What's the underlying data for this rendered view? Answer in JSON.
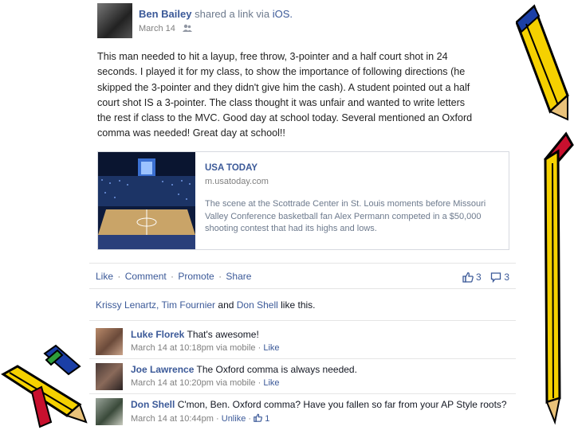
{
  "post": {
    "author": "Ben Bailey",
    "verb": "shared a link via",
    "platform": "iOS.",
    "date": "March 14",
    "message_lines": [
      "This man needed to hit a layup, free throw, 3-pointer and a half court shot in 24",
      "seconds. I played it for my class, to show the importance of following directions (he",
      "skipped the 3-pointer and they didn't give him the cash). A student pointed out a half",
      "court shot IS a 3-pointer. The class thought it was unfair and wanted to write letters",
      "the rest if class to the MVC. Good day at school today. Several mentioned an Oxford",
      "comma was needed! Great day at school!!"
    ]
  },
  "attachment": {
    "source": "USA TODAY",
    "domain": "m.usatoday.com",
    "description_lines": [
      "The scene at the Scottrade Center in St. Louis moments before Missouri",
      "Valley Conference basketball fan Alex Permann competed in a $50,000",
      "shooting contest that had its highs and lows."
    ]
  },
  "actions": {
    "like": "Like",
    "comment": "Comment",
    "promote": "Promote",
    "share": "Share",
    "like_count": "3",
    "comment_count": "3"
  },
  "likes_line": {
    "names": "Krissy Lenartz, Tim Fournier",
    "and": "and",
    "last": "Don Shell",
    "suffix": "like this."
  },
  "comments": [
    {
      "author": "Luke Florek",
      "text": "That's awesome!",
      "time": "March 14 at 10:18pm via mobile",
      "action": "Like"
    },
    {
      "author": "Joe Lawrence",
      "text": "The Oxford comma is always needed.",
      "time": "March 14 at 10:20pm via mobile",
      "action": "Like"
    },
    {
      "author": "Don Shell",
      "text": "C'mon, Ben. Oxford comma? Have you fallen so far from your AP Style roots?",
      "time": "March 14 at 10:44pm",
      "action": "Unlike",
      "like_count": "1"
    }
  ],
  "colors": {
    "link_blue": "#3b5998",
    "meta_gray": "#7f7f7f",
    "pencil_yellow": "#f5d100",
    "pencil_red": "#c8102e"
  }
}
